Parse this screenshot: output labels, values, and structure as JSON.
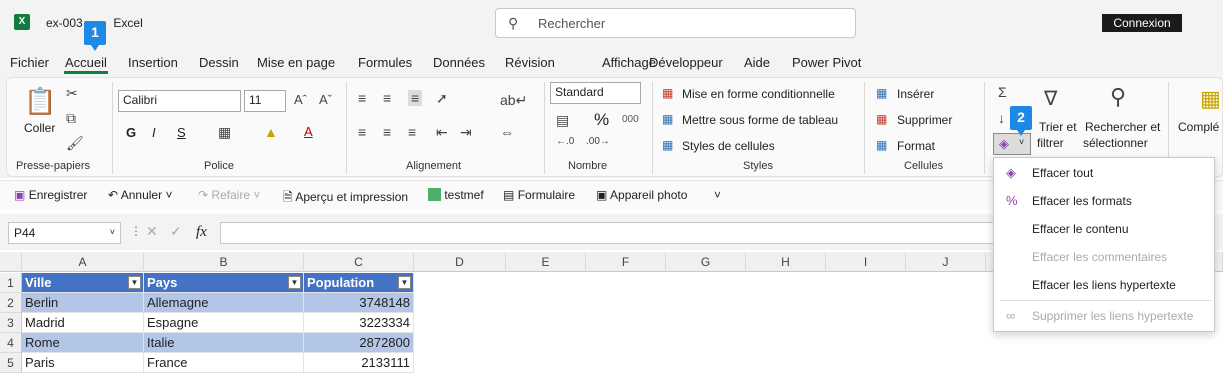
{
  "title": {
    "filename": "ex-003",
    "app": "Excel",
    "separator": "-"
  },
  "search": {
    "placeholder": "Rechercher"
  },
  "connexion_label": "Connexion",
  "menu": [
    "Fichier",
    "Accueil",
    "Insertion",
    "Dessin",
    "Mise en page",
    "Formules",
    "Données",
    "Révision",
    "Affichage",
    "Développeur",
    "Aide",
    "Power Pivot"
  ],
  "ribbon": {
    "clipboard": {
      "paste": "Coller",
      "label": "Presse-papiers"
    },
    "font": {
      "name": "Calibri",
      "size": "11",
      "bold": "G",
      "italic": "I",
      "underline": "S",
      "label": "Police"
    },
    "alignment": {
      "label": "Alignement"
    },
    "number": {
      "format": "Standard",
      "percent": "%",
      "thousands": "000",
      "label": "Nombre"
    },
    "styles": {
      "conditional": "Mise en forme conditionnelle",
      "table": "Mettre sous forme de tableau",
      "cell_styles": "Styles de cellules",
      "label": "Styles"
    },
    "cells": {
      "insert": "Insérer",
      "delete": "Supprimer",
      "format": "Format",
      "label": "Cellules"
    },
    "editing": {
      "sort1": "Trier et",
      "sort2": "filtrer",
      "find1": "Rechercher et",
      "find2": "sélectionner",
      "more": "Complé"
    }
  },
  "qat": [
    "Enregistrer",
    "Annuler",
    "Refaire",
    "Aperçu et impression",
    "testmef",
    "Formulaire",
    "Appareil photo"
  ],
  "formula_bar": {
    "name_box": "P44",
    "fx": "fx"
  },
  "columns": [
    "A",
    "B",
    "C",
    "D",
    "E",
    "F",
    "G",
    "H",
    "I",
    "J"
  ],
  "rows": [
    "1",
    "2",
    "3",
    "4",
    "5"
  ],
  "table": {
    "headers": [
      "Ville",
      "Pays",
      "Population"
    ],
    "rows": [
      [
        "Berlin",
        "Allemagne",
        "3748148"
      ],
      [
        "Madrid",
        "Espagne",
        "3223334"
      ],
      [
        "Rome",
        "Italie",
        "2872800"
      ],
      [
        "Paris",
        "France",
        "2133111"
      ]
    ]
  },
  "clear_menu": {
    "items": [
      "Effacer tout",
      "Effacer les formats",
      "Effacer le contenu",
      "Effacer les commentaires",
      "Effacer les liens hypertexte",
      "Supprimer les liens hypertexte"
    ]
  },
  "badges": [
    "1",
    "2"
  ],
  "colors": {
    "accent": "#107c41",
    "table_header": "#4472c4",
    "band": "#b4c6e7",
    "badge": "#1e88e5"
  }
}
